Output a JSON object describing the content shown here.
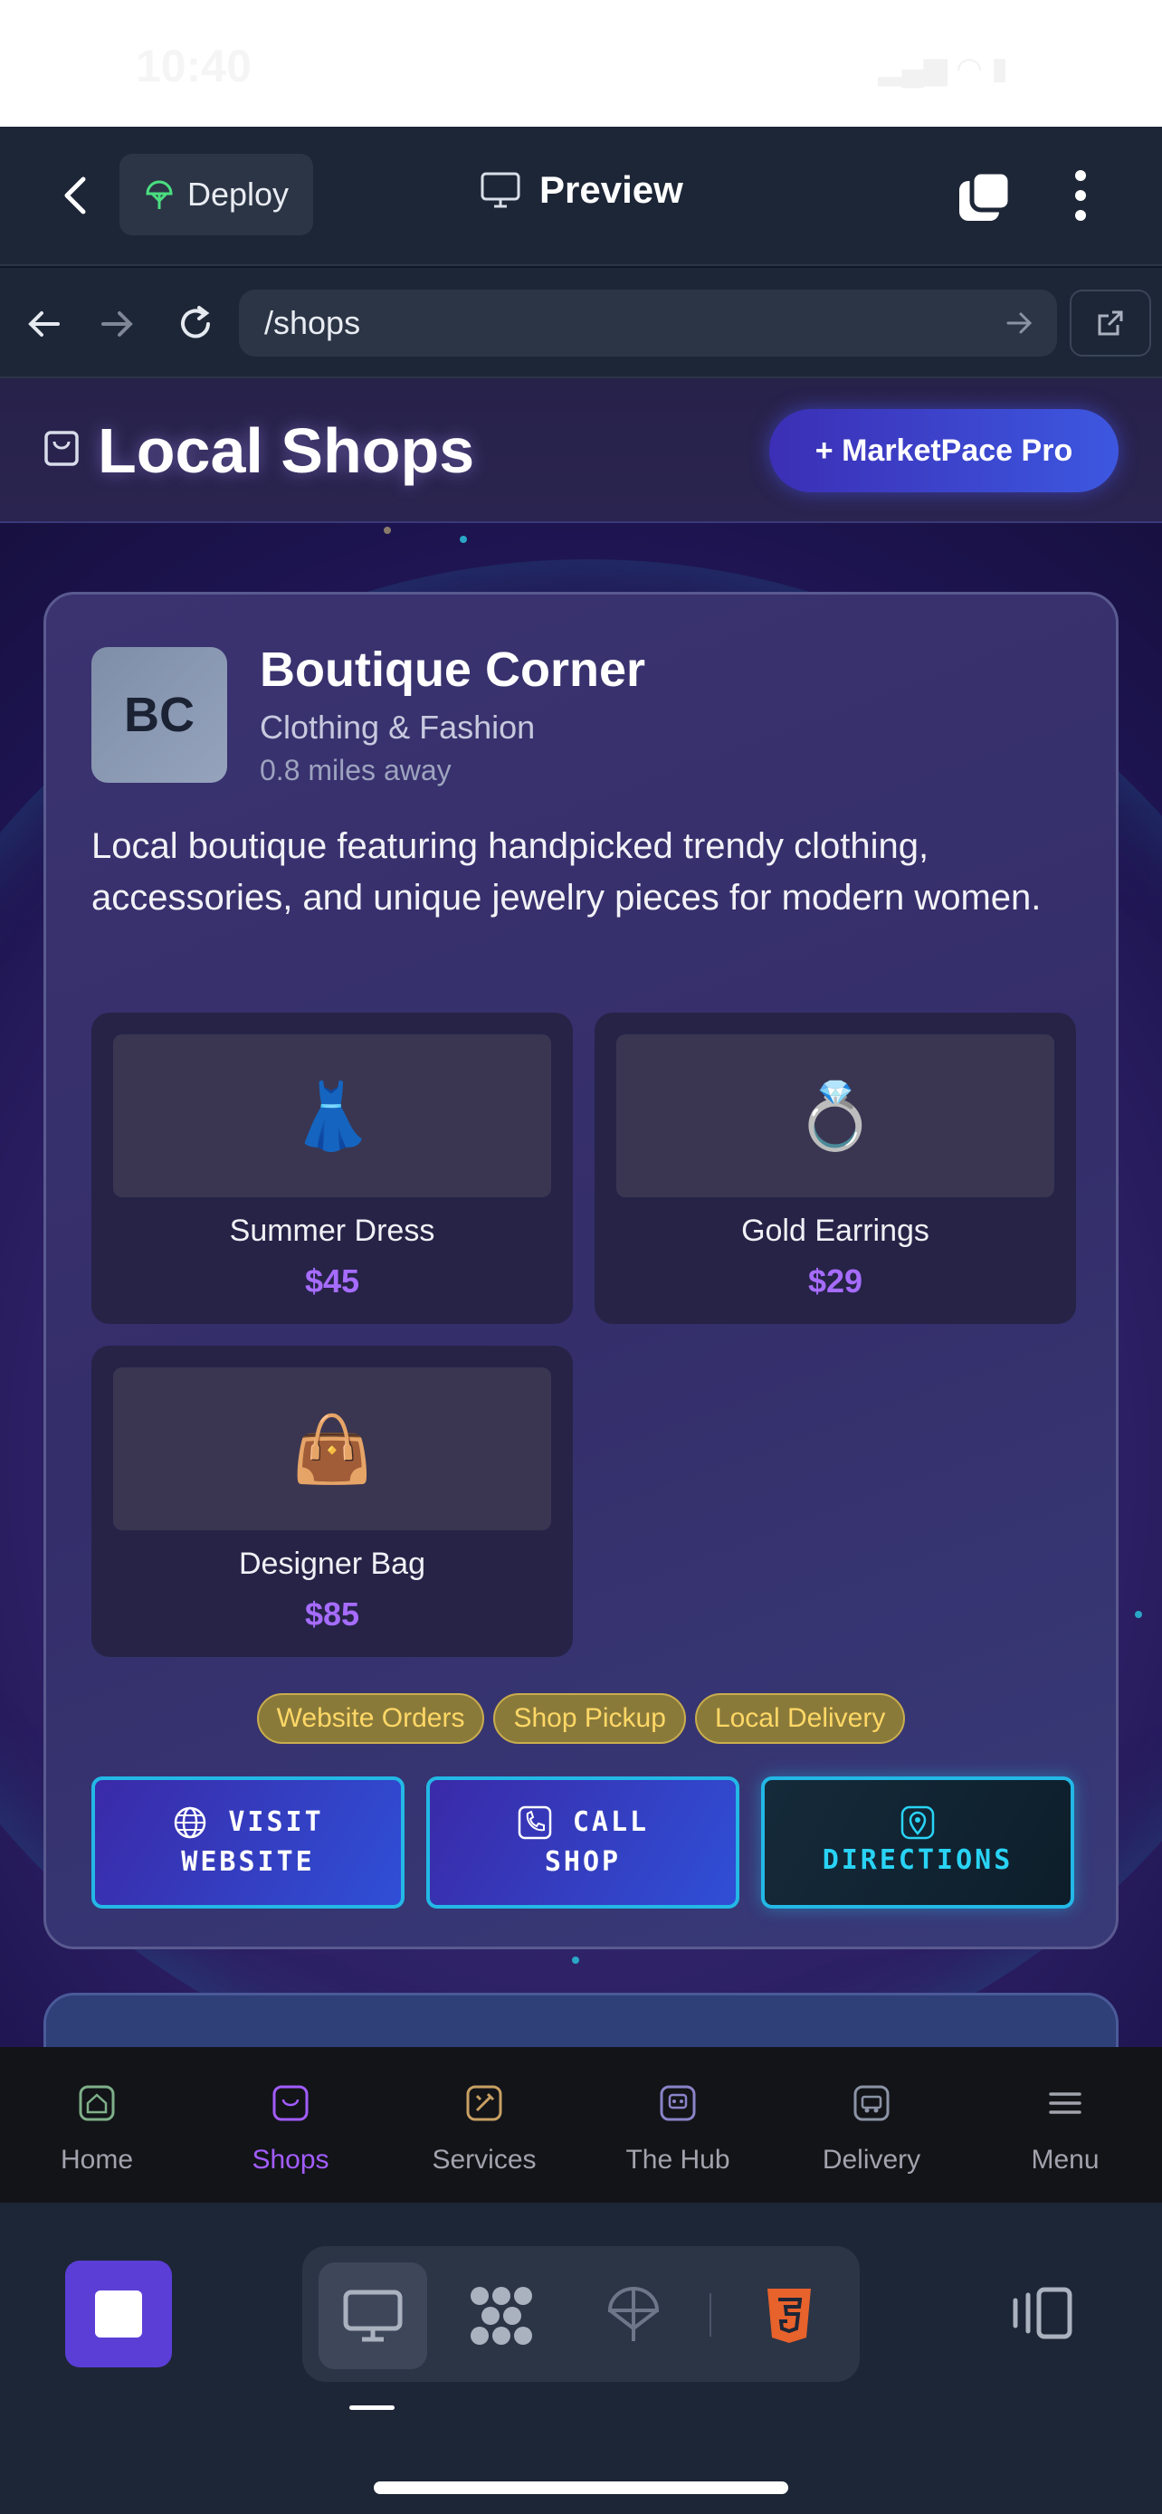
{
  "status_bar": {
    "time": "10:40"
  },
  "topbar": {
    "deploy_label": "Deploy",
    "preview_label": "Preview"
  },
  "browser": {
    "url": "/shops"
  },
  "header": {
    "title": "Local Shops",
    "pro_button": "+ MarketPace Pro"
  },
  "shop": {
    "initials": "BC",
    "name": "Boutique Corner",
    "category": "Clothing & Fashion",
    "distance": "0.8 miles away",
    "description": "Local boutique featuring handpicked trendy clothing, accessories, and unique jewelry pieces for modern women.",
    "products": [
      {
        "name": "Summer Dress",
        "price": "$45",
        "emoji": "👗"
      },
      {
        "name": "Gold Earrings",
        "price": "$29",
        "emoji": "💍"
      },
      {
        "name": "Designer Bag",
        "price": "$85",
        "emoji": "👜"
      }
    ],
    "badges": [
      "Website Orders",
      "Shop Pickup",
      "Local Delivery"
    ],
    "actions": {
      "website_1": "VISIT",
      "website_2": "WEBSITE",
      "call_1": "CALL",
      "call_2": "SHOP",
      "directions": "DIRECTIONS"
    }
  },
  "tabs": [
    {
      "label": "Home",
      "icon": "home-icon",
      "color": "#7fb089"
    },
    {
      "label": "Shops",
      "icon": "shopping-bag-icon",
      "color": "#a35cff"
    },
    {
      "label": "Services",
      "icon": "tools-icon",
      "color": "#c9a063"
    },
    {
      "label": "The Hub",
      "icon": "hub-icon",
      "color": "#8a84c8"
    },
    {
      "label": "Delivery",
      "icon": "delivery-icon",
      "color": "#8c93a6"
    },
    {
      "label": "Menu",
      "icon": "menu-icon",
      "color": "#a1a3ad"
    }
  ],
  "colors": {
    "accent": "#a35cff",
    "badge_text": "#ffd866",
    "action_border": "#23b8e6",
    "stop": "#5b3ed6"
  }
}
